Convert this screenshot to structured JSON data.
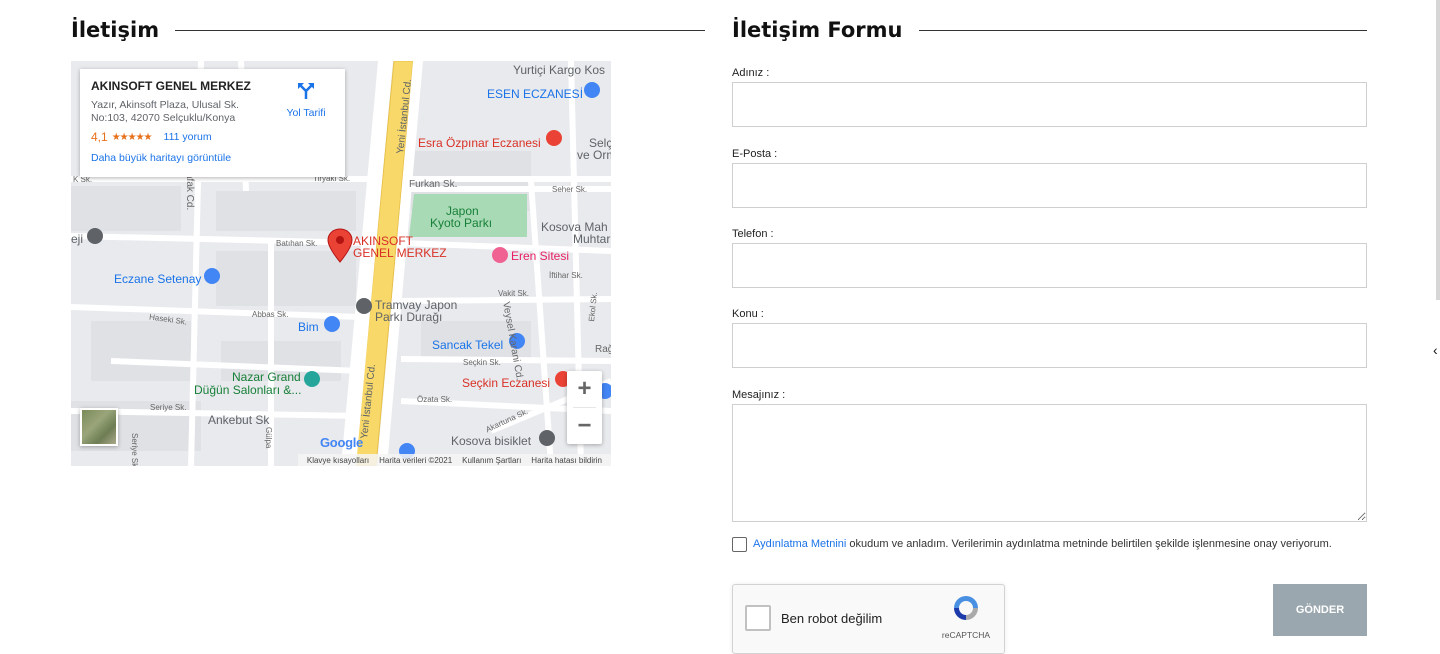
{
  "contact": {
    "title": "İletişim"
  },
  "map": {
    "place_name": "AKINSOFT GENEL MERKEZ",
    "address": "Yazır, Akinsoft Plaza, Ulusal Sk. No:103, 42070 Selçuklu/Konya",
    "rating": "4,1",
    "stars": "★★★★★",
    "reviews": "111 yorum",
    "directions_label": "Yol Tarifi",
    "bigger_map": "Daha büyük haritayı görüntüle",
    "marker_label_1": "AKINSOFT",
    "marker_label_2": "GENEL MERKEZ",
    "zoom_in": "+",
    "zoom_out": "−",
    "google": "Google",
    "footer": {
      "shortcuts": "Klavye kısayolları",
      "data": "Harita verileri ©2021",
      "terms": "Kullanım Şartları",
      "report": "Harita hatası bildirin"
    },
    "pois": {
      "yurtici": "Yurtiçi Kargo Kos",
      "esen": "ESEN ECZANESİ",
      "esra": "Esra Özpınar Eczanesi",
      "selcuk": "Selç",
      "veorm": "ve Orm",
      "japon": "Japon",
      "kyoto": "Kyoto Parkı",
      "kosova_mah": "Kosova Mah",
      "muhtar": "Muhtar",
      "eren": "Eren Sitesi",
      "eczane_setenay": "Eczane Setenay",
      "tramvay_1": "Tramvay Japon",
      "tramvay_2": "Parkı Durağı",
      "bim": "Bim",
      "sancak": "Sancak Tekel",
      "nazar_1": "Nazar Grand",
      "nazar_2": "Düğün Salonları &...",
      "seckin": "Seçkin Eczanesi",
      "kosova_bisiklet": "Kosova bisiklet",
      "ankebut": "Ankebut Sk",
      "eji": "eji"
    },
    "roads": {
      "yeni_istanbul_1": "Yeni İstanbul Cd.",
      "yeni_istanbul_2": "Yeni İstanbul Cd.",
      "furkan": "Furkan Sk.",
      "seher": "Seher Sk.",
      "tiryaki": "Tiryaki Sk.",
      "batihan": "Batıhan Sk.",
      "vakit": "Vakit Sk.",
      "iftihar": "İftihar Sk.",
      "abbas": "Abbas Sk.",
      "haseki": "Haseki Sk.",
      "seckin_sk": "Seçkin Sk.",
      "ozata": "Özata Sk.",
      "akartuna": "Akartuna Sk.",
      "seriye": "Seriye Sk.",
      "veysel": "Veysel Karani Cd.",
      "ekol": "Ekol Sk.",
      "rag": "Rağ",
      "afak": "afak Cd.",
      "ksk": "K Sk.",
      "gulpa": "Gülpa",
      "seriye2": "Seriye Sk"
    }
  },
  "form": {
    "title": "İletişim Formu",
    "name_label": "Adınız :",
    "email_label": "E-Posta :",
    "phone_label": "Telefon :",
    "subject_label": "Konu :",
    "message_label": "Mesajınız :",
    "consent_link": "Aydınlatma Metnini",
    "consent_text": " okudum ve anladım. Verilerimin aydınlatma metninde belirtilen şekilde işlenmesine onay veriyorum.",
    "recaptcha_label": "Ben robot değilim",
    "recaptcha_brand": "reCAPTCHA",
    "submit": "GÖNDER"
  }
}
